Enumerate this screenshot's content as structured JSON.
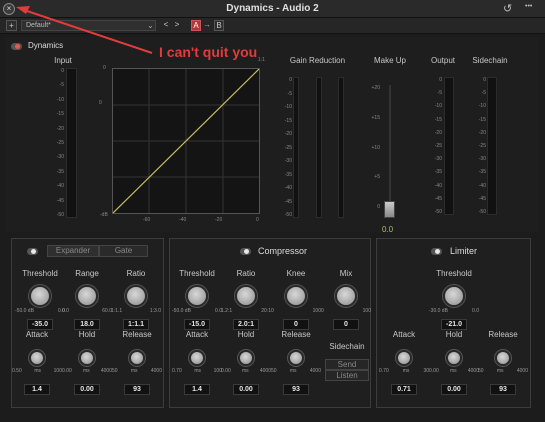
{
  "window": {
    "title": "Dynamics - Audio 2",
    "close": "×",
    "history_icon": "↺",
    "more_icon": "•••"
  },
  "toolbar": {
    "add": "+",
    "preset": "Default*",
    "chevron": "⌄",
    "prev": "<",
    "next": ">",
    "a": "A",
    "arrow": "→",
    "b": "B"
  },
  "annotation": "I can't quit you",
  "dynamics": {
    "label": "Dynamics",
    "input": "Input",
    "gain_reduction": "Gain Reduction",
    "make_up": "Make Up",
    "output": "Output",
    "sidechain": "Sidechain",
    "makeup_value": "0.0"
  },
  "scales": {
    "meter": [
      "0",
      "-5",
      "-10",
      "-15",
      "-20",
      "-25",
      "-30",
      "-35",
      "-40",
      "-45",
      "-50"
    ],
    "gr": [
      "0",
      "-5",
      "-10",
      "-15",
      "-20",
      "-25",
      "-30",
      "-35",
      "-40",
      "-45",
      "-50"
    ],
    "makeup": [
      "+20",
      "+15",
      "+10",
      "+5",
      "0"
    ],
    "gy": [
      "0",
      "-50"
    ],
    "gx": [
      "-dB",
      "-60",
      "-40",
      "-20",
      "0"
    ],
    "gtop": "0",
    "gright": "1:1"
  },
  "expander": {
    "tab1": "Expander",
    "tab2": "Gate",
    "threshold": {
      "label": "Threshold",
      "range": [
        "-50.0 dB",
        "0.0"
      ],
      "value": "-35.0"
    },
    "range": {
      "label": "Range",
      "range": [
        "0.0",
        "60.0"
      ],
      "value": "18.0"
    },
    "ratio": {
      "label": "Ratio",
      "range": [
        "1:1.1",
        "1:3.0"
      ],
      "value": "1:1.1"
    },
    "attack": {
      "label": "Attack",
      "range": [
        "0.50",
        "ms",
        "100"
      ],
      "value": "1.4"
    },
    "hold": {
      "label": "Hold",
      "range": [
        "0.00",
        "ms",
        "4000"
      ],
      "value": "0.00"
    },
    "release": {
      "label": "Release",
      "range": [
        "50",
        "ms",
        "4000"
      ],
      "value": "93"
    }
  },
  "compressor": {
    "title": "Compressor",
    "threshold": {
      "label": "Threshold",
      "range": [
        "-50.0 dB",
        "0.0"
      ],
      "value": "-15.0"
    },
    "ratio": {
      "label": "Ratio",
      "range": [
        "1.2:1",
        "20:1"
      ],
      "value": "2.0:1"
    },
    "knee": {
      "label": "Knee",
      "range": [
        "0",
        "100"
      ],
      "value": "0"
    },
    "mix": {
      "label": "Mix",
      "range": [
        "0",
        "100"
      ],
      "value": "0"
    },
    "attack": {
      "label": "Attack",
      "range": [
        "0.70",
        "ms",
        "100"
      ],
      "value": "1.4"
    },
    "hold": {
      "label": "Hold",
      "range": [
        "0.00",
        "ms",
        "4000"
      ],
      "value": "0.00"
    },
    "release": {
      "label": "Release",
      "range": [
        "50",
        "ms",
        "4000"
      ],
      "value": "93"
    },
    "sidechain": {
      "label": "Sidechain",
      "send": "Send",
      "listen": "Listen"
    }
  },
  "limiter": {
    "title": "Limiter",
    "threshold": {
      "label": "Threshold",
      "range": [
        "-30.0 dB",
        "0.0"
      ],
      "value": "-21.0"
    },
    "attack": {
      "label": "Attack",
      "range": [
        "0.70",
        "ms",
        "30"
      ],
      "value": "0.71"
    },
    "hold": {
      "label": "Hold",
      "range": [
        "0.00",
        "ms",
        "4000"
      ],
      "value": "0.00"
    },
    "release": {
      "label": "Release",
      "range": [
        "50",
        "ms",
        "4000"
      ],
      "value": "93"
    }
  },
  "colors": {
    "accent_red": "#e03c3c",
    "curve": "#c8c060",
    "value_green": "#a0c060"
  }
}
